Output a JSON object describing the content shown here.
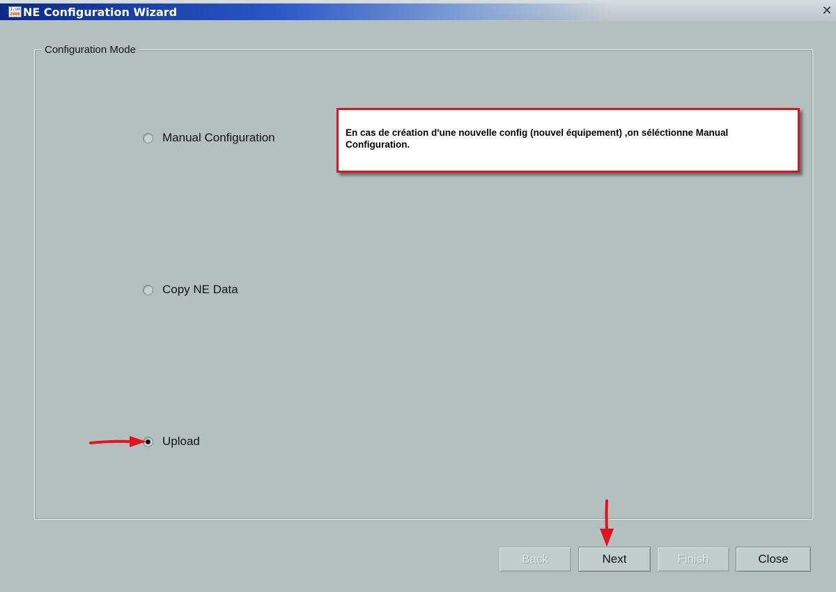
{
  "window": {
    "title": "NE Configuration Wizard",
    "app_icon_lines": [
      "1.vm",
      "2000"
    ],
    "close_glyph": "✕"
  },
  "group": {
    "legend": "Configuration Mode"
  },
  "options": [
    {
      "label": "Manual Configuration",
      "selected": false
    },
    {
      "label": "Copy NE Data",
      "selected": false
    },
    {
      "label": "Upload",
      "selected": true
    }
  ],
  "annotation": {
    "text": "En cas de création d'une nouvelle config (nouvel équipement) ,on séléctionne Manual Configuration.",
    "border_color": "#e0141c"
  },
  "buttons": {
    "back": "Back",
    "next": "Next",
    "finish": "Finish",
    "close": "Close"
  },
  "colors": {
    "background": "#b4c0c0",
    "title_bar": "#0a2a8a",
    "arrow": "#e0141c"
  }
}
